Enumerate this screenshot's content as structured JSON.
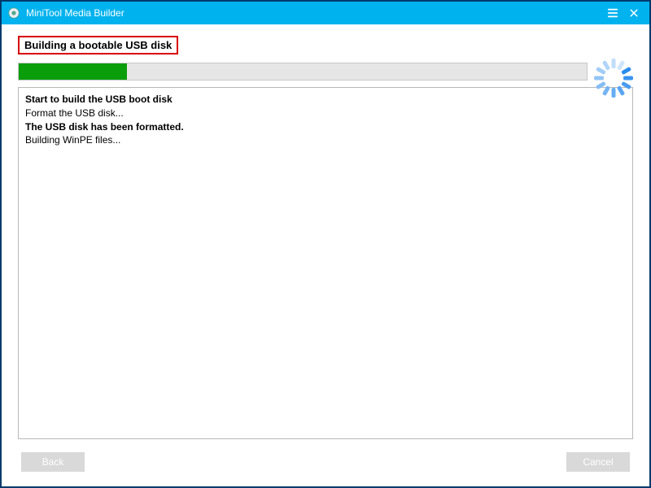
{
  "titlebar": {
    "app_name": "MiniTool Media Builder"
  },
  "header": {
    "label": "Building a bootable USB disk"
  },
  "progress": {
    "percent": 19
  },
  "log": [
    {
      "text": "Start to build the USB boot disk",
      "bold": true
    },
    {
      "text": "Format the USB disk...",
      "bold": false
    },
    {
      "text": "The USB disk has been formatted.",
      "bold": true
    },
    {
      "text": "Building WinPE files...",
      "bold": false
    }
  ],
  "footer": {
    "back_label": "Back",
    "cancel_label": "Cancel"
  },
  "colors": {
    "titlebar_bg": "#00b2ee",
    "accent_border": "#d80000",
    "progress_fill": "#0b9e0b"
  }
}
